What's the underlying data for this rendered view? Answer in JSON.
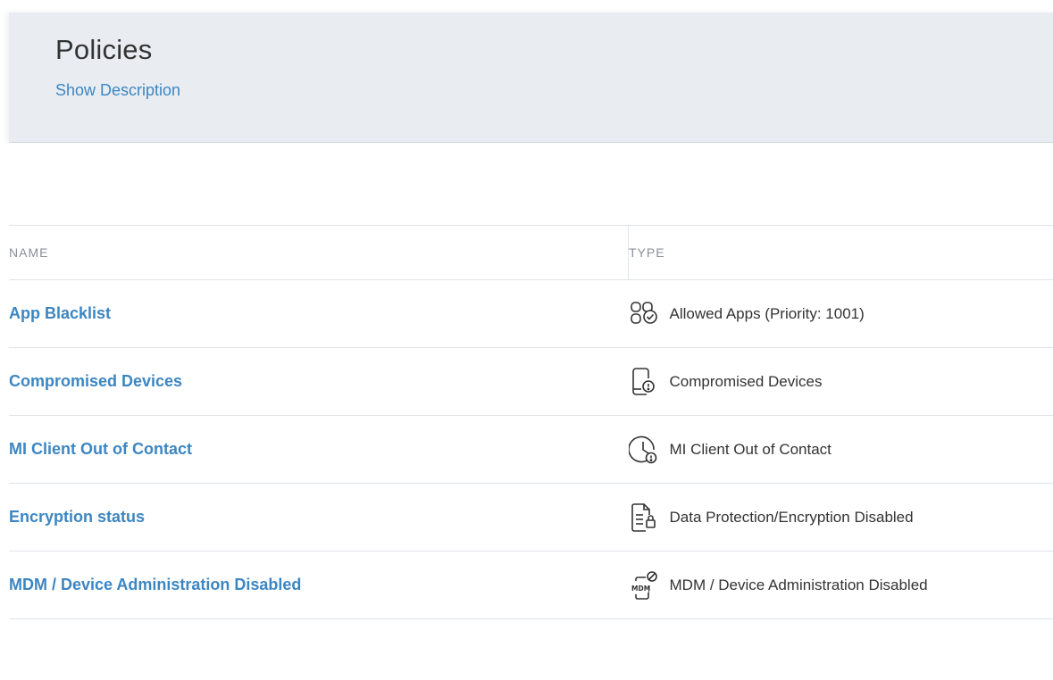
{
  "header": {
    "title": "Policies",
    "show_description": "Show Description"
  },
  "table": {
    "columns": {
      "name": "NAME",
      "type": "TYPE"
    },
    "rows": [
      {
        "name": "App Blacklist",
        "type": "Allowed Apps (Priority: 1001)",
        "icon": "allowed-apps-icon"
      },
      {
        "name": "Compromised Devices",
        "type": "Compromised Devices",
        "icon": "compromised-device-icon"
      },
      {
        "name": "MI Client Out of Contact",
        "type": "MI Client Out of Contact",
        "icon": "clock-alert-icon"
      },
      {
        "name": "Encryption status",
        "type": "Data Protection/Encryption Disabled",
        "icon": "document-lock-icon"
      },
      {
        "name": "MDM / Device Administration Disabled",
        "type": "MDM / Device Administration Disabled",
        "icon": "mdm-disabled-icon"
      }
    ]
  },
  "colors": {
    "link": "#3c86c2",
    "header_bg": "#e9edf2",
    "border": "#dfe3e8",
    "muted_text": "#8a8f96"
  }
}
